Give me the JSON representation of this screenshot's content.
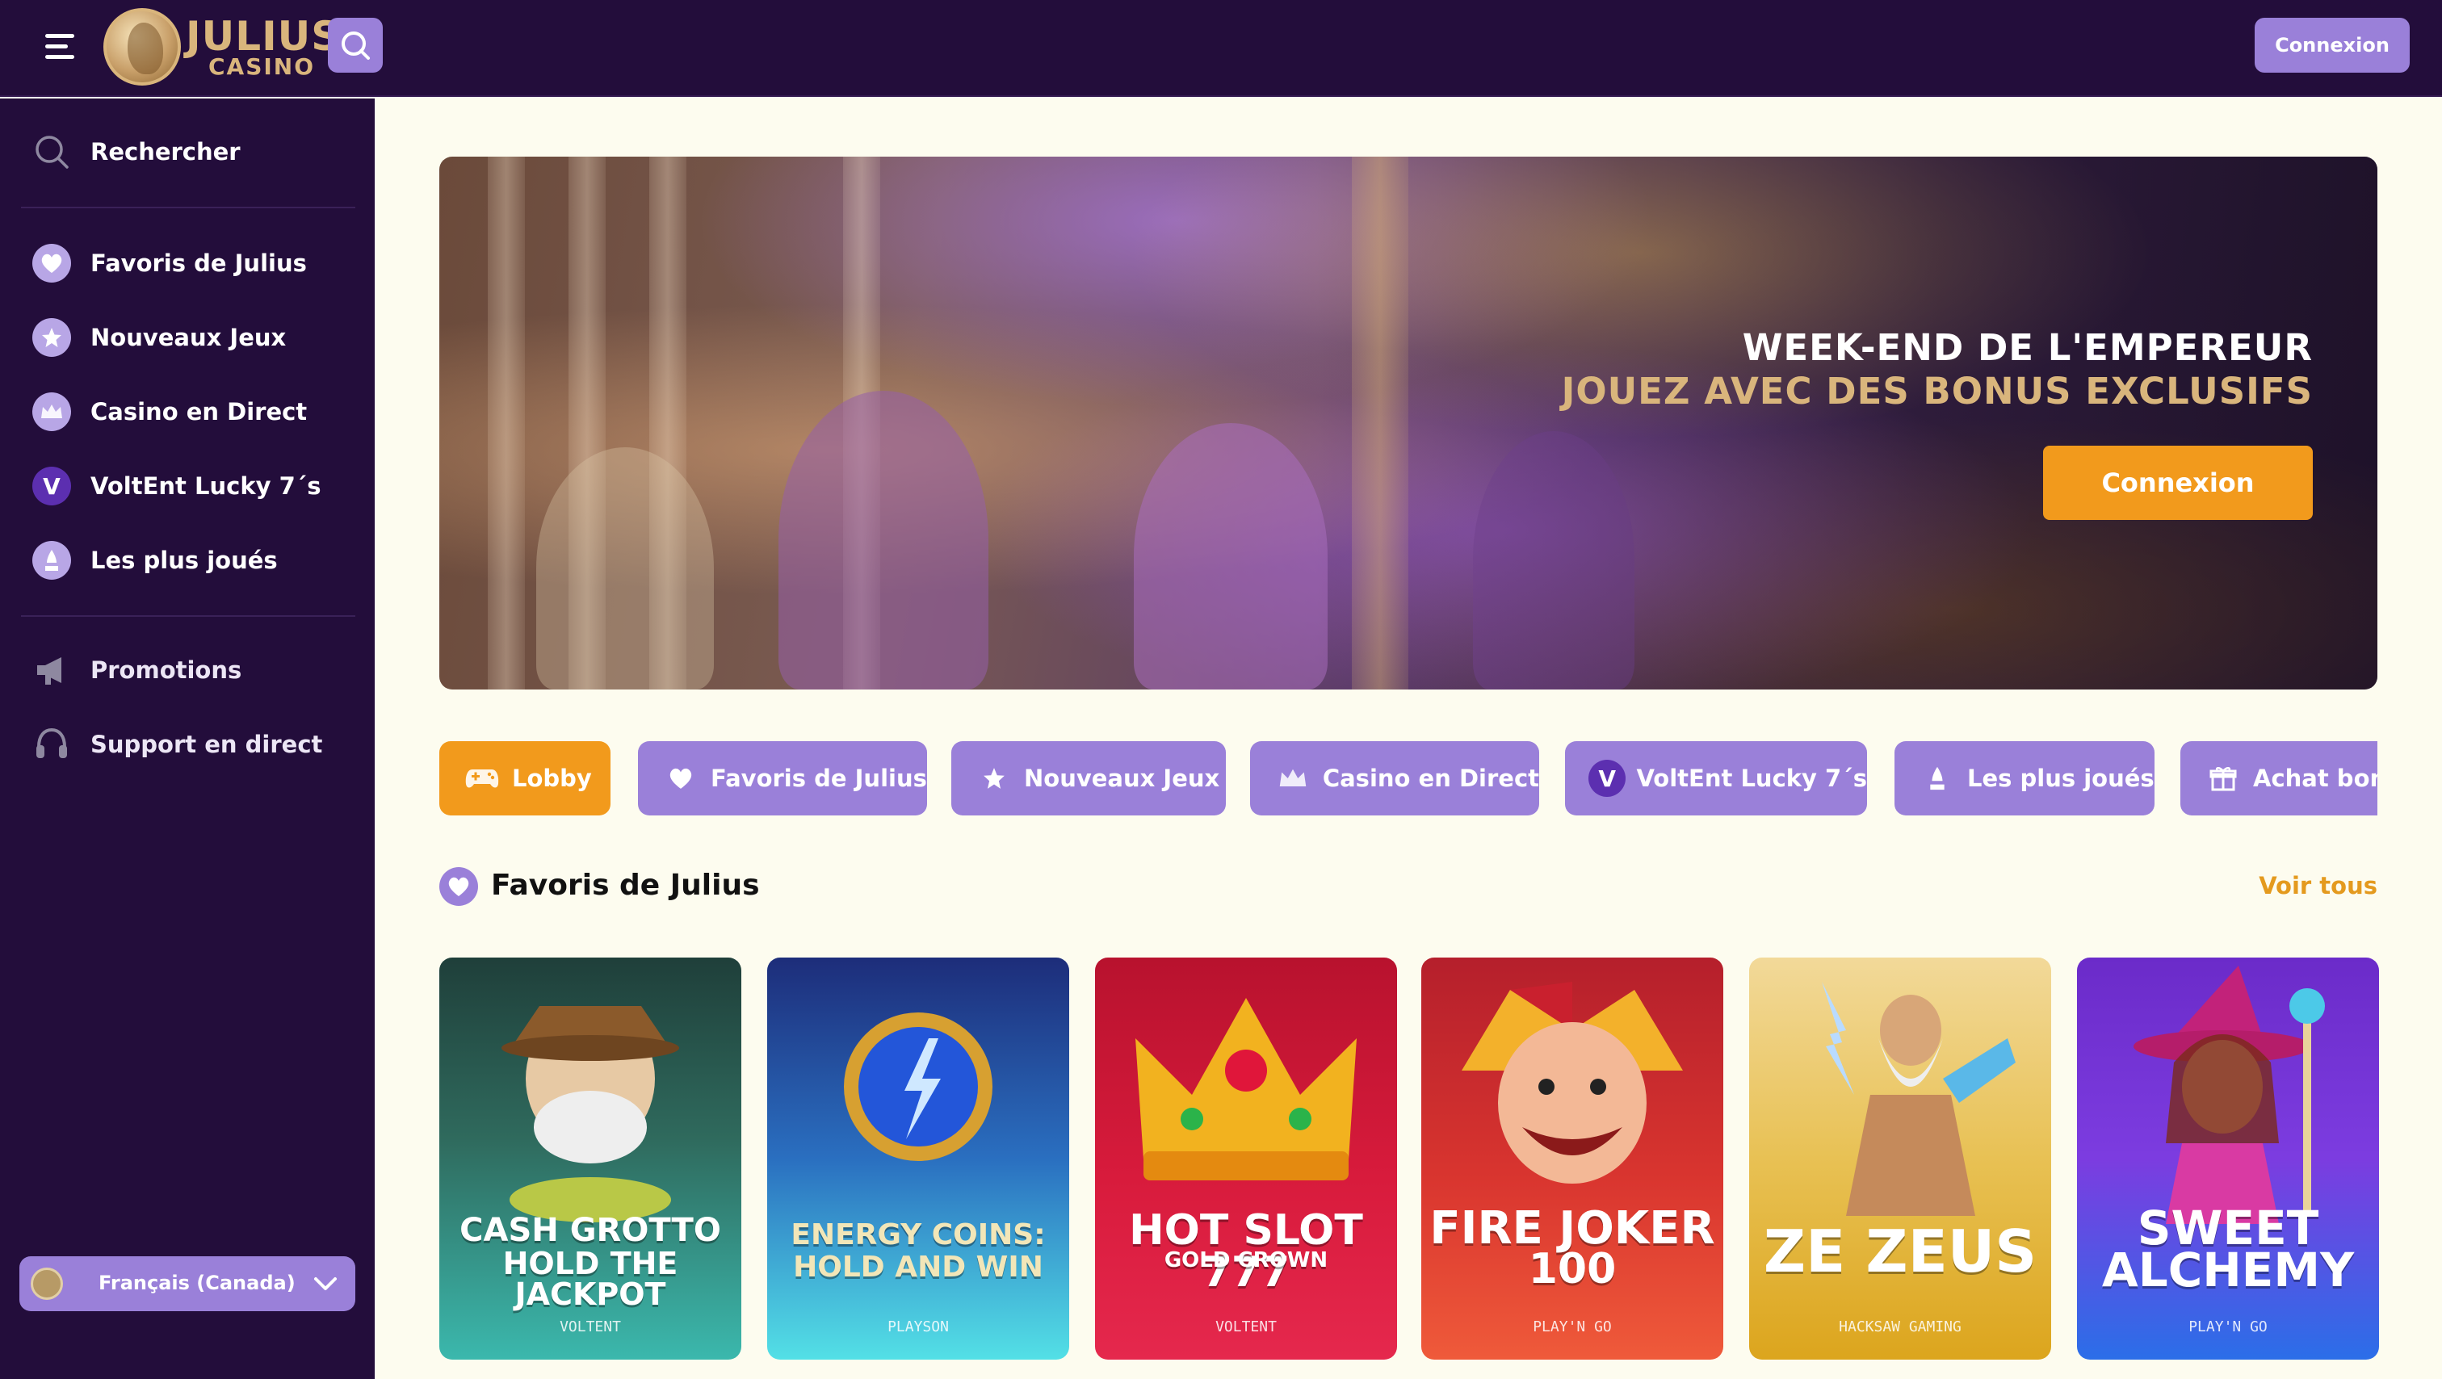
{
  "header": {
    "logo_word1": "JULIUS",
    "logo_word2": "CASINO",
    "login_label": "Connexion"
  },
  "sidebar": {
    "search_label": "Rechercher",
    "items": [
      {
        "label": "Favoris de Julius",
        "icon": "heart-icon"
      },
      {
        "label": "Nouveaux Jeux",
        "icon": "star-icon"
      },
      {
        "label": "Casino en Direct",
        "icon": "crown-icon"
      },
      {
        "label": "VoltEnt Lucky 7´s",
        "icon": "v-icon"
      },
      {
        "label": "Les plus joués",
        "icon": "trophy-icon"
      }
    ],
    "extra_items": [
      {
        "label": "Promotions",
        "icon": "megaphone-icon"
      },
      {
        "label": "Support en direct",
        "icon": "headset-icon"
      }
    ],
    "language": "Français (Canada)"
  },
  "hero": {
    "title": "WEEK-END DE L'EMPEREUR",
    "subtitle": "JOUEZ AVEC DES BONUS EXCLUSIFS",
    "cta": "Connexion"
  },
  "chips": [
    {
      "label": "Lobby",
      "icon": "gamepad-icon",
      "active": true
    },
    {
      "label": "Favoris de Julius",
      "icon": "heart-icon"
    },
    {
      "label": "Nouveaux Jeux",
      "icon": "star-icon"
    },
    {
      "label": "Casino en Direct",
      "icon": "crown-icon"
    },
    {
      "label": "VoltEnt Lucky 7´s",
      "icon": "v-icon"
    },
    {
      "label": "Les plus joués",
      "icon": "trophy-icon"
    },
    {
      "label": "Achat bonu",
      "icon": "gift-icon"
    }
  ],
  "section": {
    "title": "Favoris de Julius",
    "see_all": "Voir tous"
  },
  "games": [
    {
      "title_line1": "CASH GROTTO",
      "title_line2": "HOLD THE JACKPOT",
      "provider": "VOLTENT"
    },
    {
      "title_line1": "ENERGY COINS:",
      "title_line2": "HOLD AND WIN",
      "provider": "PLAYSON"
    },
    {
      "title_line1": "HOT SLOT 777",
      "title_line2": "GOLD CROWN",
      "provider": "VOLTENT"
    },
    {
      "title_line1": "FIRE JOKER",
      "title_line2": "100",
      "provider": "PLAY'N GO"
    },
    {
      "title_line1": "ZE ZEUS",
      "title_line2": "",
      "provider": "HACKSAW GAMING"
    },
    {
      "title_line1": "SWEET",
      "title_line2": "ALCHEMY",
      "provider": "PLAY'N GO"
    }
  ],
  "colors": {
    "nav_bg": "#230d3b",
    "accent_purple": "#9a80d9",
    "accent_orange": "#f29a1c",
    "gold": "#d9b57c",
    "page_bg": "#fdfcef"
  }
}
